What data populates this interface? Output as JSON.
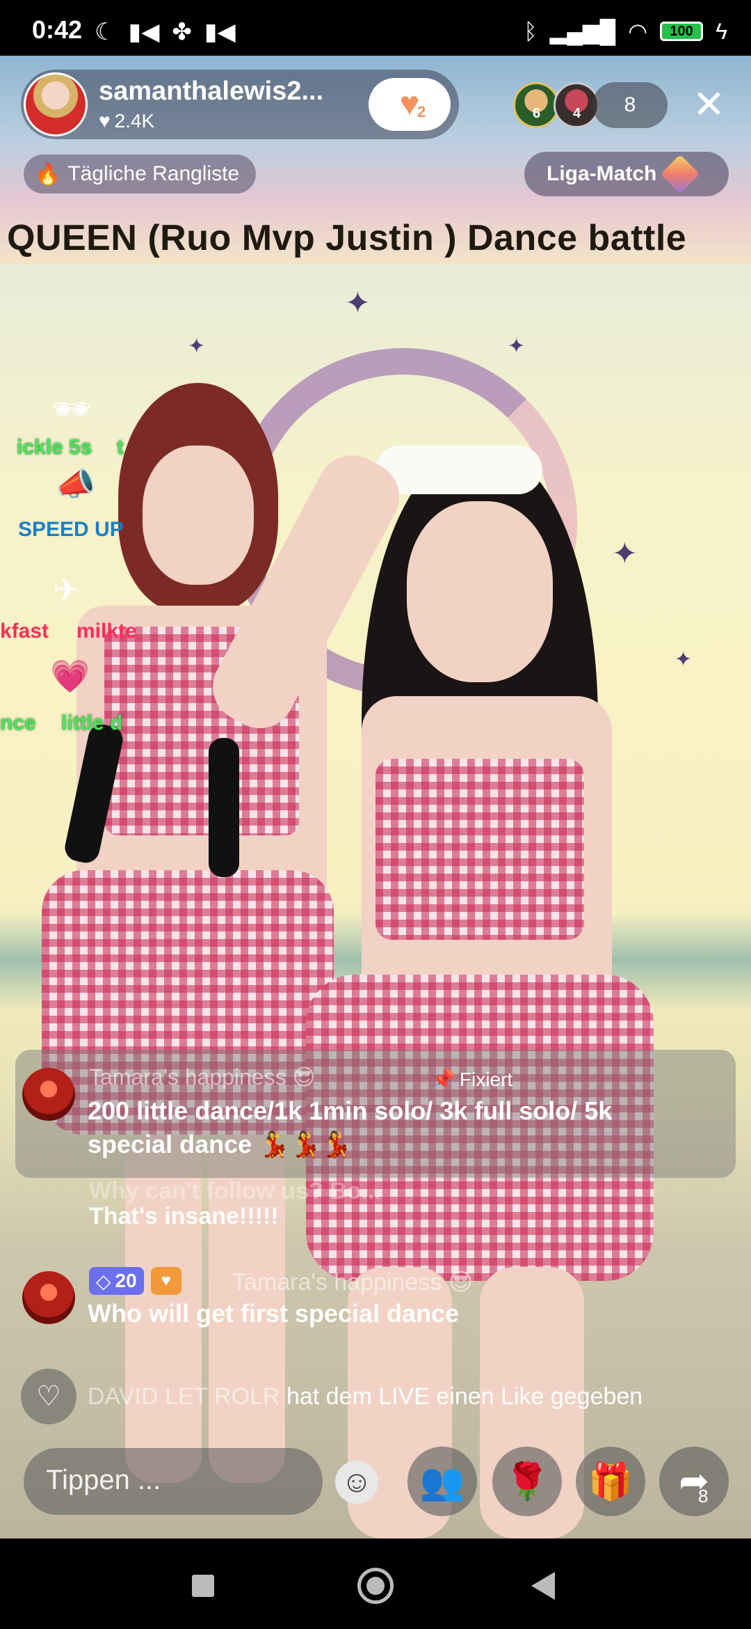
{
  "status_bar": {
    "time": "0:42",
    "battery": "100",
    "left_icons": [
      "moon-icon",
      "video-icon",
      "fan-icon",
      "video-icon"
    ],
    "right_icons": [
      "bluetooth-icon",
      "signal-icon",
      "wifi-icon",
      "battery-icon",
      "charging-icon"
    ]
  },
  "header": {
    "host_name": "samanthalewis2...",
    "host_likes": "2.4K",
    "follow_badge": "2",
    "top_viewers": [
      {
        "rank": "6"
      },
      {
        "rank": "4"
      }
    ],
    "viewer_count": "8",
    "ranking_label": "Tägliche Rangliste",
    "league_label": "Liga-Match"
  },
  "marquee": {
    "text": "QUEEN (Ruo Mvp Justin )    Dance battle"
  },
  "stickers": {
    "s1": "ickle 5s",
    "s2": "t",
    "s3": "SPEED UP",
    "s4": "kfast",
    "s5": "milkte",
    "s6": "nce",
    "s7": "little d"
  },
  "chat": {
    "pinned": {
      "user": "Tamara's happiness 😎",
      "tag": "Fixiert",
      "text": "200 little dance/1k 1min solo/ 3k full solo/ 5k special dance 💃💃💃"
    },
    "faded_line_1": "Why can't follow us? Bo...",
    "faded_line_2": "That's insane!!!!!",
    "message": {
      "level": "20",
      "user": "Tamara's happiness 😎",
      "text": "Who will get first special dance"
    },
    "like_event": {
      "user": "DAVID LET ROLR",
      "text": "hat dem LIVE einen Like gegeben"
    }
  },
  "bottom_bar": {
    "input_placeholder": "Tippen ...",
    "share_count": "8"
  }
}
